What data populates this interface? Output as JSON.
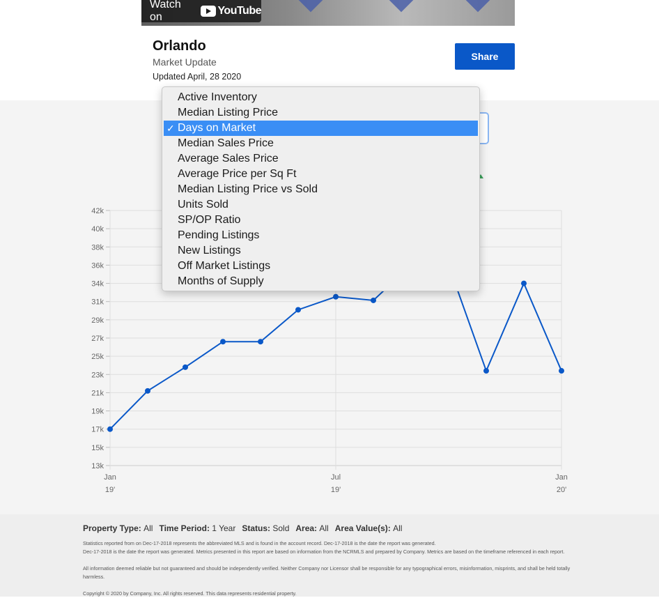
{
  "video": {
    "watch_label": "Watch on",
    "youtube_label": "YouTube"
  },
  "header": {
    "city": "Orlando",
    "subtitle": "Market Update",
    "updated": "Updated April, 28 2020",
    "share_label": "Share"
  },
  "metric_menu": {
    "selected": "Days on Market",
    "check": "✓",
    "items": [
      "Active Inventory",
      "Median Listing Price",
      "Days on Market",
      "Median Sales Price",
      "Average Sales Price",
      "Average Price per Sq Ft",
      "Median Listing Price vs Sold",
      "Units Sold",
      "SP/OP Ratio",
      "Pending Listings",
      "New Listings",
      "Off Market Listings",
      "Months of Supply"
    ]
  },
  "chart_data": {
    "type": "line",
    "title": "",
    "xlabel": "",
    "ylabel": "",
    "y_ticks": [
      "13k",
      "15k",
      "17k",
      "19k",
      "21k",
      "23k",
      "25k",
      "27k",
      "29k",
      "31k",
      "34k",
      "36k",
      "38k",
      "40k",
      "42k"
    ],
    "x_ticks": [
      {
        "line1": "Jan",
        "line2": "19'"
      },
      {
        "line1": "Jul",
        "line2": "19'"
      },
      {
        "line1": "Jan",
        "line2": "20'"
      }
    ],
    "x": [
      "Jan 19'",
      "Feb 19'",
      "Mar 19'",
      "Apr 19'",
      "May 19'",
      "Jun 19'",
      "Jul 19'",
      "Aug 19'",
      "Sep 19'",
      "Oct 19'",
      "Nov 19'",
      "Dec 19'",
      "Jan 20'"
    ],
    "values": [
      17000,
      21200,
      23800,
      26600,
      26600,
      30100,
      31800,
      31200,
      36000,
      36000,
      23400,
      34000,
      23400
    ],
    "ylim": [
      13000,
      42000
    ],
    "grid": true,
    "line_color": "#0a58c8"
  },
  "footer": {
    "filters": [
      {
        "label": "Property Type:",
        "value": "All"
      },
      {
        "label": "Time Period:",
        "value": "1 Year"
      },
      {
        "label": "Status:",
        "value": "Sold"
      },
      {
        "label": "Area:",
        "value": "All"
      },
      {
        "label": "Area Value(s):",
        "value": "All"
      }
    ],
    "disclaimer_1": "Statistics reported from on Dec-17-2018 represents the abbreviated MLS and is found in the account record. Dec-17-2018 is the date the report was generated.",
    "disclaimer_2": "Dec-17-2018 is the date the report was generated. Metrics presented in this report are based on information from the NCRMLS and prepared by Company. Metrics are based on the timeframe referenced in each report.",
    "disclaimer_3": "All information deemed reliable but not guaranteed and should be independently verified. Neither Company nor Licensor shall be responsible for any typographical errors, misinformation, misprints, and shall be held totally harmless.",
    "copyright": "Copyright © 2020 by Company, Inc. All rights reserved. This data represents residential property."
  }
}
